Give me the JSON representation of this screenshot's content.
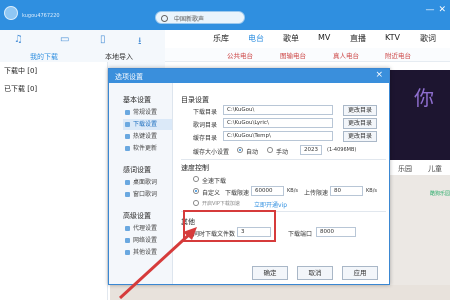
{
  "topbar": {
    "username": "kugou4767220",
    "search_placeholder": "中国新歌声"
  },
  "leftnav": {
    "tabs": [
      "我的下载",
      "本地导入"
    ],
    "list": [
      "下载中 [0]",
      "已下载 [0]"
    ]
  },
  "mainnav": {
    "items": [
      "乐库",
      "电台",
      "歌单",
      "MV",
      "直播",
      "KTV",
      "歌词"
    ],
    "sub": [
      "公共电台",
      "图输电台",
      "真人电台",
      "附近电台"
    ]
  },
  "background": {
    "banner_text": "你",
    "categories": [
      "乐园",
      "儿童"
    ],
    "music_tag": "酷狗乐园"
  },
  "dialog": {
    "title": "选项设置",
    "sidebar": {
      "groups": [
        "基本设置",
        "感词设置",
        "高级设置"
      ],
      "items": [
        "常规设置",
        "下载设置",
        "热键设置",
        "软件更新",
        "桌面歌词",
        "窗口歌词",
        "代理设置",
        "网络设置",
        "其他设置"
      ]
    },
    "dir": {
      "section": "目录设置",
      "download_label": "下载目录",
      "download_path": "C:\\KuGou\\",
      "lyrics_label": "歌词目录",
      "lyrics_path": "C:\\KuGou\\Lyric\\",
      "cache_label": "缓存目录",
      "cache_path": "C:\\KuGou\\Temp\\",
      "change_btn": "更改目录",
      "cache_size_label": "缓存大小设置",
      "auto": "自动",
      "manual": "手动",
      "cache_size": "2023",
      "cache_size_hint": "(1-4096MB)"
    },
    "speed": {
      "section": "速度控制",
      "full": "全速下载",
      "custom": "自定义",
      "down_label": "下载限速",
      "down_val": "60000",
      "unit": "KB/s",
      "up_label": "上传限速",
      "up_val": "80",
      "vip_label": "开启VIP下载加速",
      "vip_link": "立即开通vip"
    },
    "other": {
      "section": "其他",
      "max_label": "同时下载文件数",
      "max_val": "3",
      "port_label": "下载端口",
      "port_val": "8000"
    },
    "buttons": {
      "ok": "确定",
      "cancel": "取消",
      "apply": "应用"
    }
  }
}
